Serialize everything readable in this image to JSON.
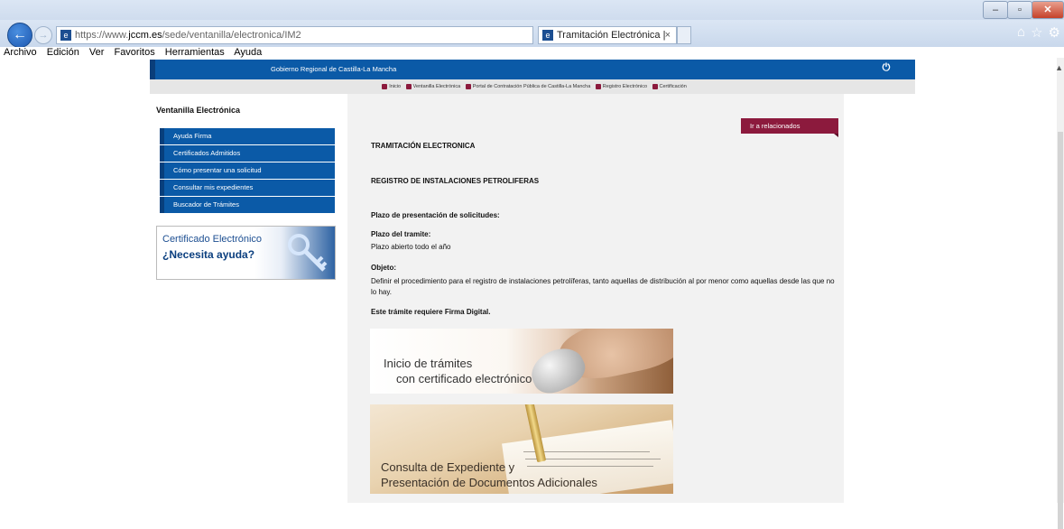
{
  "browser": {
    "url_prefix": "https://www.",
    "url_host": "jccm.es",
    "url_path": "/sede/ventanilla/electronica/IM2",
    "tab_title": "Tramitación Electrónica | S...",
    "tab_close": "×",
    "menu": [
      "Archivo",
      "Edición",
      "Ver",
      "Favoritos",
      "Herramientas",
      "Ayuda"
    ]
  },
  "header": {
    "title": "Gobierno Regional de Castilla-La Mancha"
  },
  "breadcrumbs": [
    "Inicio",
    "Ventanilla Electrónica",
    "Portal de Contratación Pública de Castilla-La Mancha",
    "Registro Electrónico",
    "Certificación"
  ],
  "sidebar": {
    "heading": "Ventanilla Electrónica",
    "items": [
      {
        "label": "Ayuda Firma"
      },
      {
        "label": "Certificados Admitidos"
      },
      {
        "label": "Cómo presentar una solicitud"
      },
      {
        "label": "Consultar mis expedientes"
      },
      {
        "label": "Buscador de Trámites"
      }
    ],
    "banner": {
      "line1": "Certificado Electrónico",
      "line2": "¿Necesita ayuda?"
    }
  },
  "main": {
    "related_button": "Ir a relacionados",
    "section_title": "TRAMITACIÓN ELECTRONICA",
    "procedure_title": "REGISTRO DE INSTALACIONES PETROLIFERAS",
    "deadline_label": "Plazo de presentación de solicitudes:",
    "term_label": "Plazo del tramite:",
    "term_value": "Plazo abierto todo el año",
    "object_label": "Objeto:",
    "object_text": "Definir el procedimiento para el registro de instalaciones petrolíferas, tanto aquellas de distribución al por menor como aquellas desde las que no lo hay.",
    "signature_note": "Este trámite requiere Firma Digital.",
    "start_banner": {
      "line1": "Inicio de trámites",
      "line2": "con certificado electrónico"
    },
    "consult_banner": {
      "line1": "Consulta de Expediente y",
      "line2": "Presentación de Documentos Adicionales"
    }
  },
  "colors": {
    "primary": "#0b5aa7",
    "accent": "#8c1a3d"
  }
}
